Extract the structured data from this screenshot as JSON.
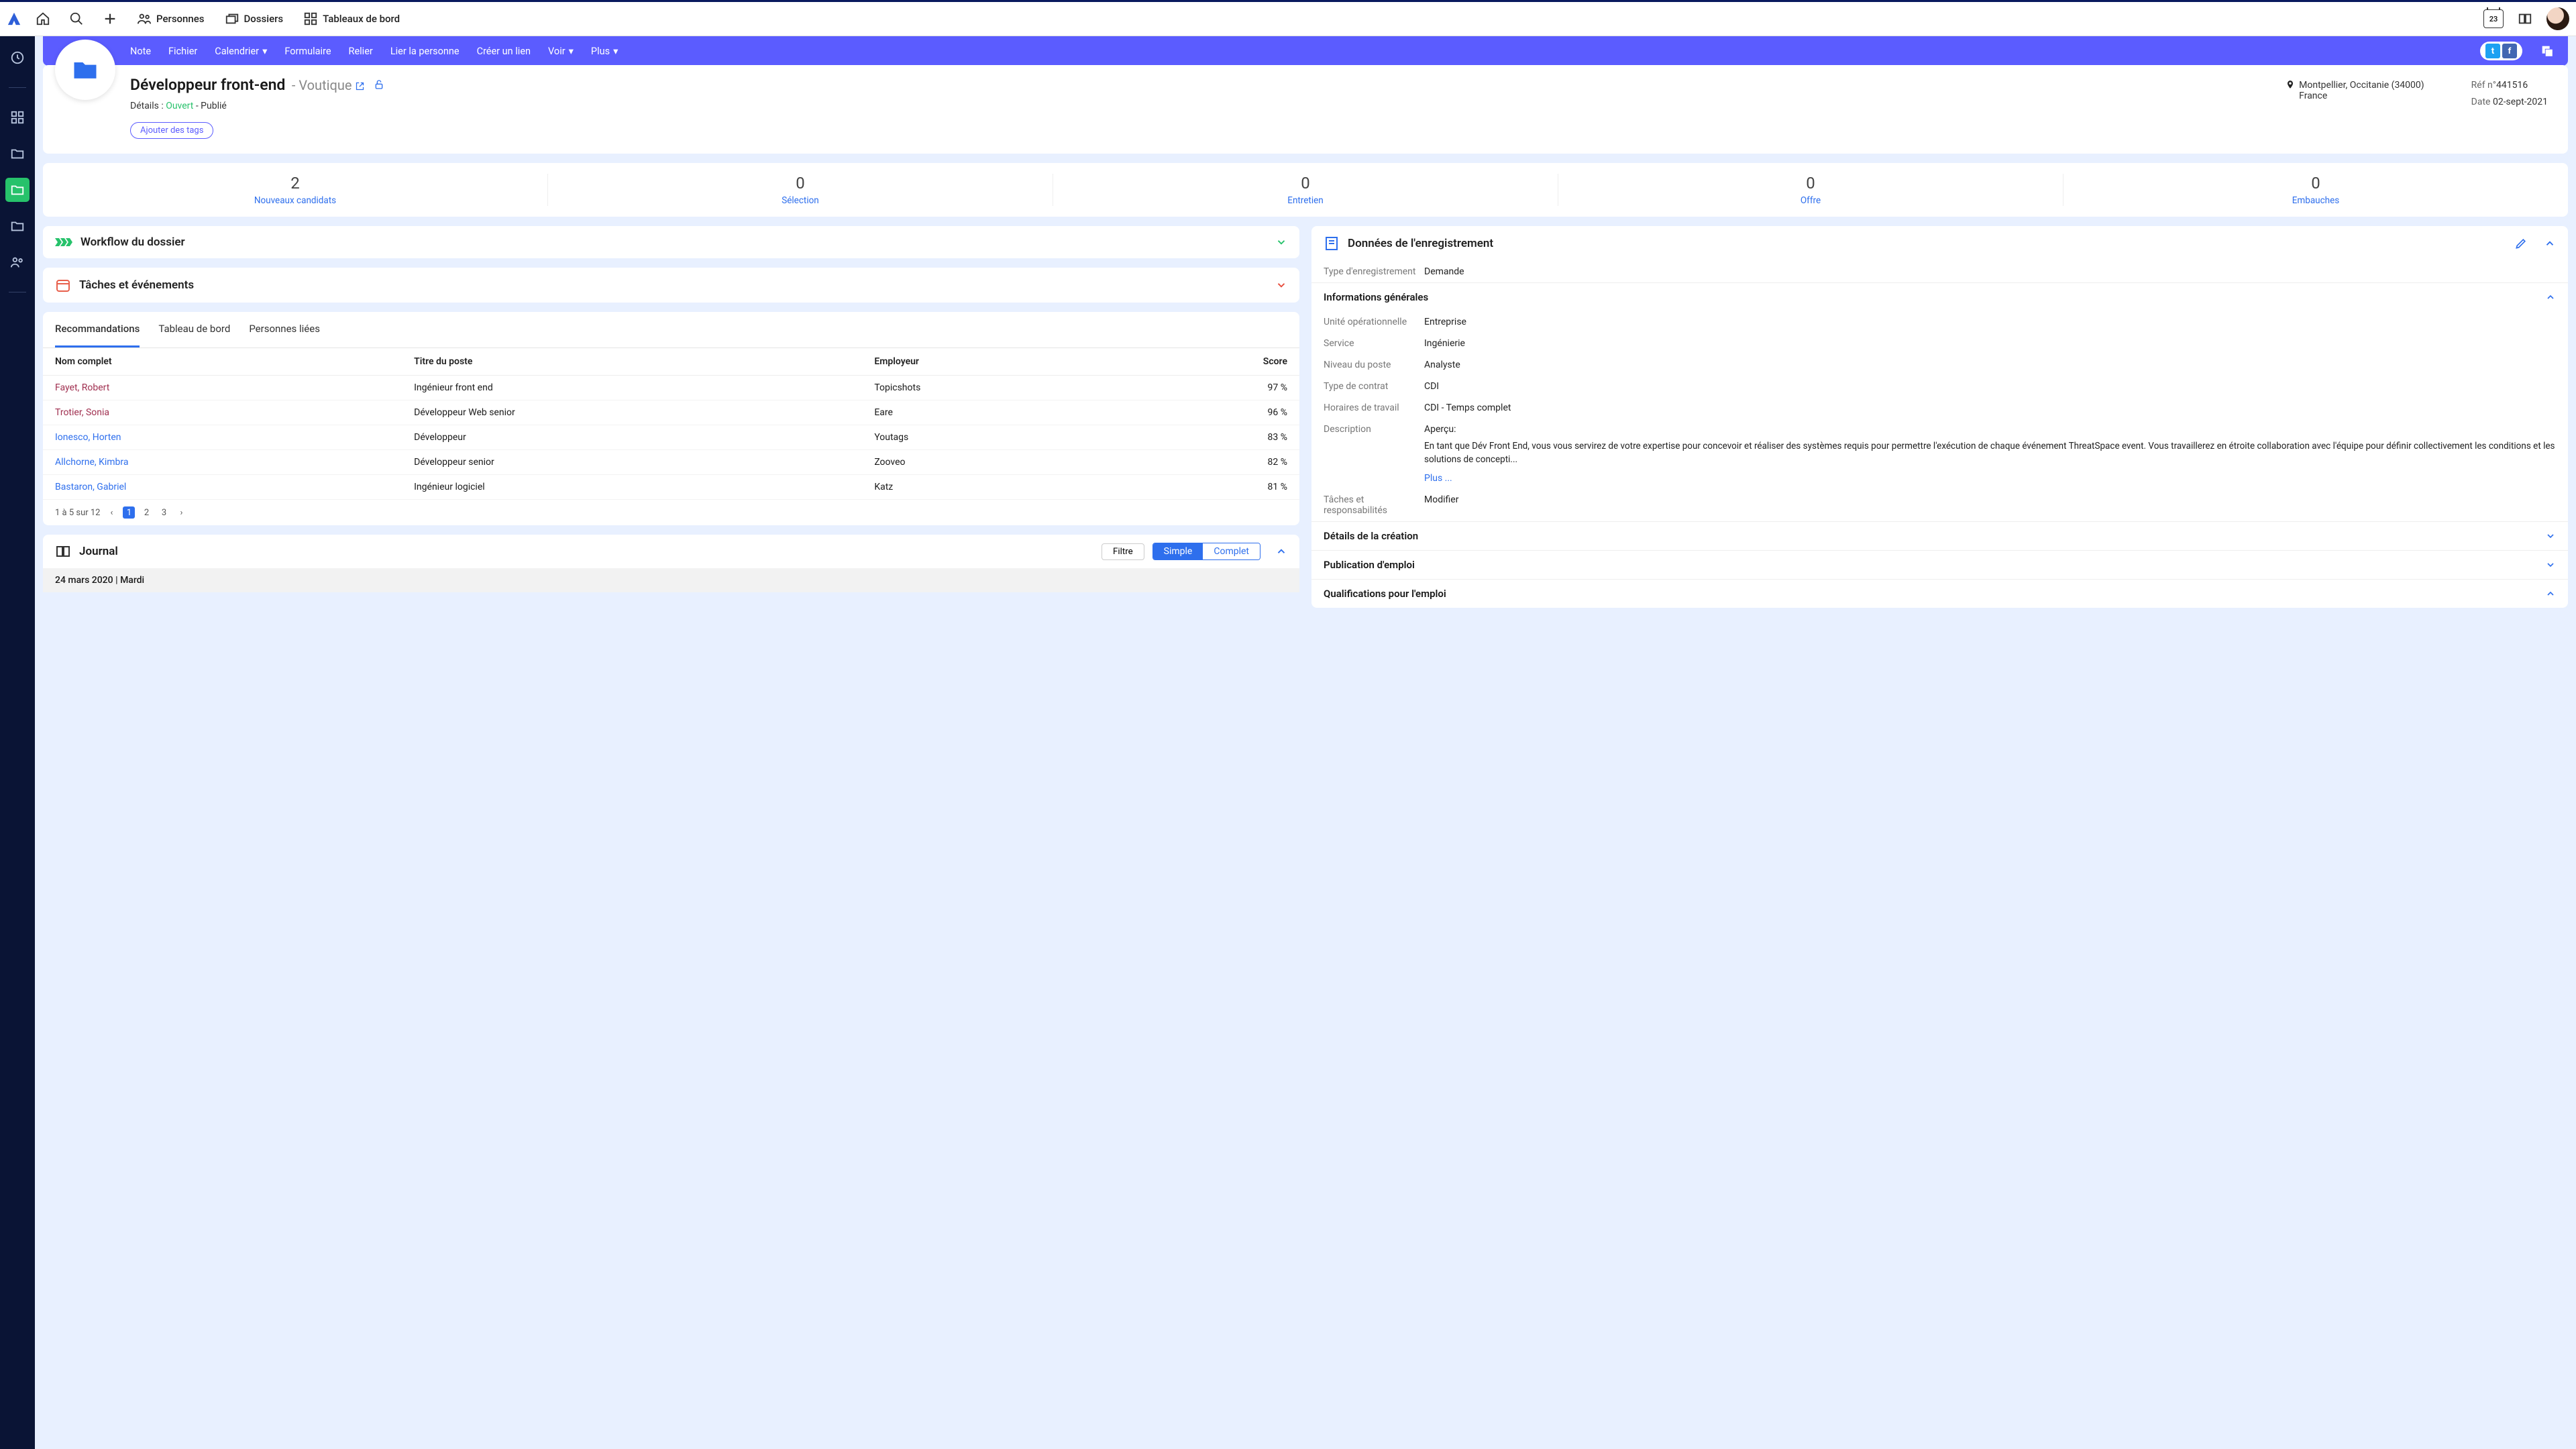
{
  "topnav": {
    "personnes": "Personnes",
    "dossiers": "Dossiers",
    "tableaux": "Tableaux de bord",
    "calendar_day": "23"
  },
  "toolbar": {
    "note": "Note",
    "fichier": "Fichier",
    "calendrier": "Calendrier",
    "formulaire": "Formulaire",
    "relier": "Relier",
    "lier_personne": "Lier la personne",
    "creer_lien": "Créer un lien",
    "voir": "Voir",
    "plus": "Plus"
  },
  "header": {
    "title": "Développeur front-end",
    "company": "- Voutique",
    "details_label": "Détails :",
    "status_open": "Ouvert",
    "status_sep": " - ",
    "status_pub": "Publié",
    "add_tags": "Ajouter des tags",
    "location_line1": "Montpellier, Occitanie (34000)",
    "location_line2": "France",
    "ref_label": "Réf n°",
    "ref_value": "441516",
    "date_label": "Date",
    "date_value": "02-sept-2021"
  },
  "stages": [
    {
      "count": "2",
      "label": "Nouveaux candidats"
    },
    {
      "count": "0",
      "label": "Sélection"
    },
    {
      "count": "0",
      "label": "Entretien"
    },
    {
      "count": "0",
      "label": "Offre"
    },
    {
      "count": "0",
      "label": "Embauches"
    }
  ],
  "panels": {
    "workflow": "Workflow du dossier",
    "tasks": "Tâches et événements",
    "record_data": "Données de l'enregistrement",
    "journal": "Journal"
  },
  "tabs": {
    "recommandations": "Recommandations",
    "tableau": "Tableau de bord",
    "personnes_liees": "Personnes liées"
  },
  "table": {
    "headers": {
      "name": "Nom complet",
      "title": "Titre du poste",
      "employer": "Employeur",
      "score": "Score"
    },
    "rows": [
      {
        "name": "Fayet, Robert",
        "link": "red",
        "title": "Ingénieur front end",
        "employer": "Topicshots",
        "score": "97 %"
      },
      {
        "name": "Trotier, Sonia",
        "link": "red",
        "title": "Développeur Web senior",
        "employer": "Eare",
        "score": "96 %"
      },
      {
        "name": "Ionesco, Horten",
        "link": "blue",
        "title": "Développeur",
        "employer": "Youtags",
        "score": "83 %"
      },
      {
        "name": "Allchorne, Kimbra",
        "link": "blue",
        "title": "Développeur senior",
        "employer": "Zooveo",
        "score": "82 %"
      },
      {
        "name": "Bastaron, Gabriel",
        "link": "blue",
        "title": "Ingénieur logiciel",
        "employer": "Katz",
        "score": "81 %"
      }
    ],
    "pager_text": "1 à 5 sur 12",
    "pages": [
      "1",
      "2",
      "3"
    ]
  },
  "record": {
    "type_label": "Type d'enregistrement",
    "type_value": "Demande",
    "section_general": "Informations générales",
    "fields": [
      {
        "k": "Unité opérationnelle",
        "v": "Entreprise"
      },
      {
        "k": "Service",
        "v": "Ingénierie"
      },
      {
        "k": "Niveau du poste",
        "v": "Analyste"
      },
      {
        "k": "Type de contrat",
        "v": "CDI"
      },
      {
        "k": "Horaires de travail",
        "v": "CDI - Temps complet"
      }
    ],
    "desc_label": "Description",
    "desc_apercu": "Aperçu:",
    "desc_text": "En tant que Dév Front End, vous vous servirez de votre expertise pour concevoir et réaliser des systèmes requis pour permettre l'exécution de chaque événement ThreatSpace event. Vous travaillerez en étroite collaboration avec l'équipe pour définir collectivement les conditions et les solutions de concepti...",
    "plus": "Plus ...",
    "taches_label": "Tâches et responsabilités",
    "taches_value": "Modifier",
    "section_creation": "Détails de la création",
    "section_publication": "Publication d'emploi",
    "section_qualif": "Qualifications pour l'emploi"
  },
  "journal": {
    "filtre": "Filtre",
    "simple": "Simple",
    "complet": "Complet",
    "date": "24 mars 2020",
    "sep": " | ",
    "day": "Mardi"
  }
}
